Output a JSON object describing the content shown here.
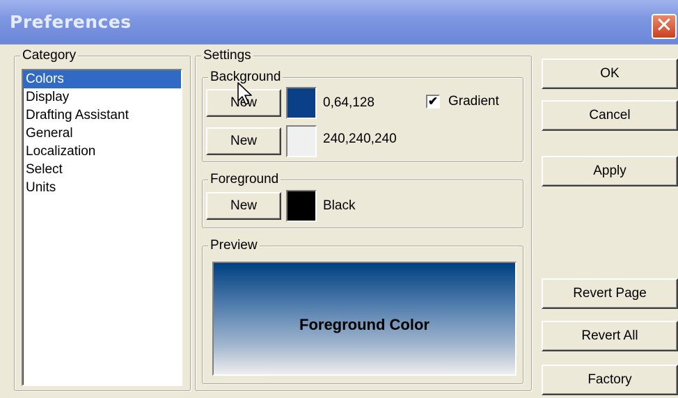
{
  "window": {
    "title": "Preferences",
    "close_glyph": "✕"
  },
  "category": {
    "label": "Category",
    "items": [
      {
        "label": "Colors",
        "selected": true
      },
      {
        "label": "Display",
        "selected": false
      },
      {
        "label": "Drafting Assistant",
        "selected": false
      },
      {
        "label": "General",
        "selected": false
      },
      {
        "label": "Localization",
        "selected": false
      },
      {
        "label": "Select",
        "selected": false
      },
      {
        "label": "Units",
        "selected": false
      }
    ]
  },
  "settings": {
    "label": "Settings",
    "background": {
      "label": "Background",
      "rows": [
        {
          "button": "New",
          "color": "#0a4088",
          "value": "0,64,128"
        },
        {
          "button": "New",
          "color": "#f0f0f0",
          "value": "240,240,240"
        }
      ],
      "gradient": {
        "label": "Gradient",
        "checked": true,
        "mark": "✔"
      }
    },
    "foreground": {
      "label": "Foreground",
      "button": "New",
      "color": "#000000",
      "value": "Black"
    },
    "preview": {
      "label": "Preview",
      "text": "Foreground Color"
    }
  },
  "actions": {
    "ok": "OK",
    "cancel": "Cancel",
    "apply": "Apply",
    "revert_page": "Revert Page",
    "revert_all": "Revert All",
    "factory": "Factory"
  }
}
